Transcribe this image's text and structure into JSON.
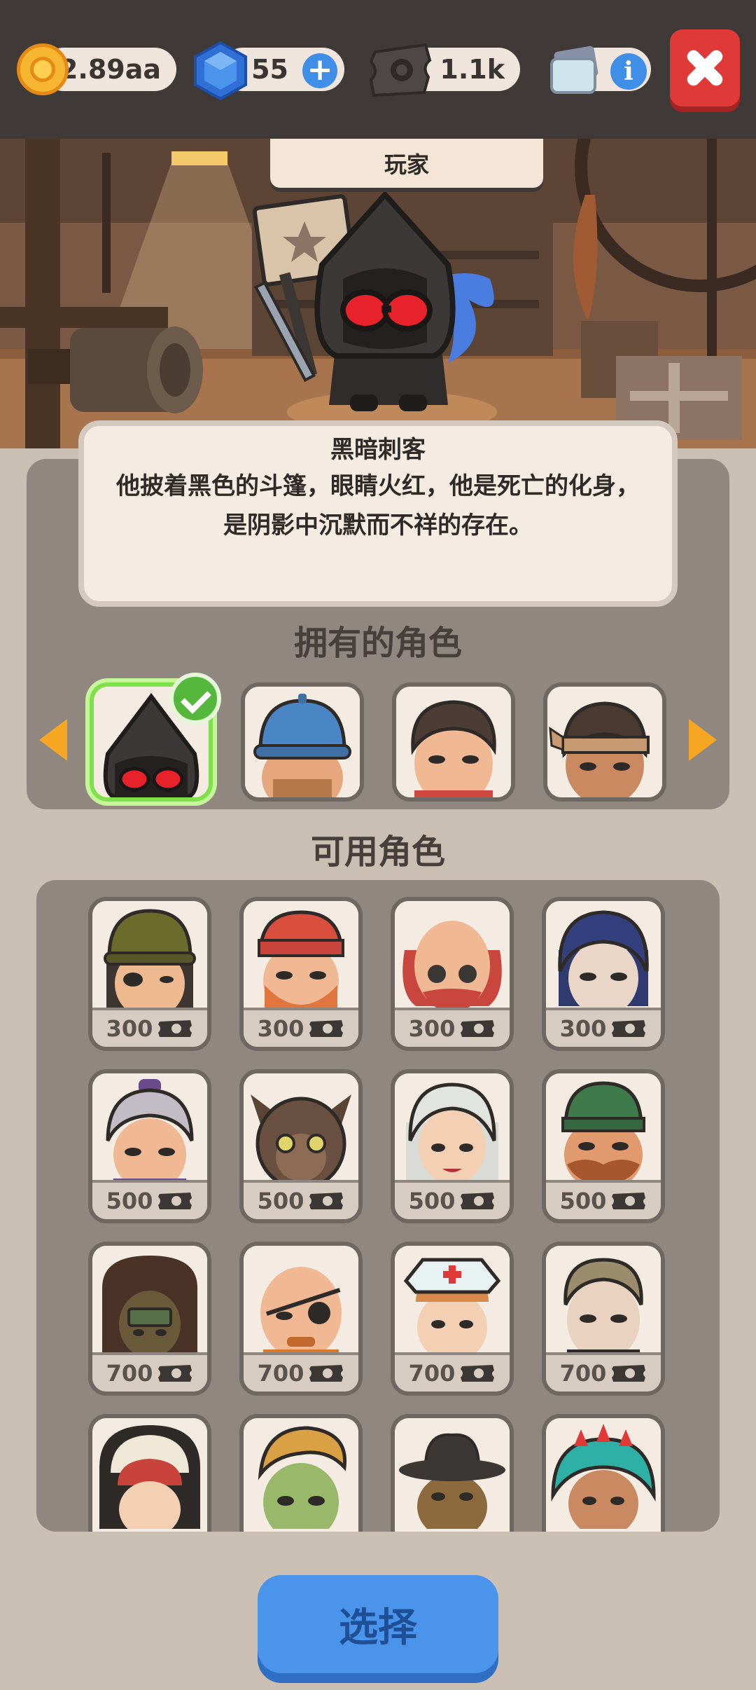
{
  "currency": {
    "coins": "2.89aa",
    "gems": "55",
    "tickets": "1.1k"
  },
  "header": {
    "player_label": "玩家"
  },
  "selected_character": {
    "name": "黑暗刺客",
    "description_line1": "他披着黑色的斗篷，眼睛火红，他是死亡的化身，",
    "description_line2": "是阴影中沉默而不祥的存在。"
  },
  "sections": {
    "owned_title": "拥有的角色",
    "available_title": "可用角色"
  },
  "owned_characters": [
    {
      "name": "dark-assassin",
      "selected": true
    },
    {
      "name": "blue-cap"
    },
    {
      "name": "brown-hair"
    },
    {
      "name": "headband-warrior"
    }
  ],
  "available_characters": [
    {
      "name": "army-helmet-eyepatch",
      "price": "300"
    },
    {
      "name": "red-beanie-beard",
      "price": "300"
    },
    {
      "name": "bald-red-beard-glasses",
      "price": "300"
    },
    {
      "name": "dark-blue-hair",
      "price": "300"
    },
    {
      "name": "granny-bun",
      "price": "500"
    },
    {
      "name": "werewolf",
      "price": "500"
    },
    {
      "name": "silver-hair-girl",
      "price": "500"
    },
    {
      "name": "green-beanie-mustache",
      "price": "500"
    },
    {
      "name": "dreadlocks",
      "price": "700"
    },
    {
      "name": "bald-eyepatch",
      "price": "700"
    },
    {
      "name": "nurse",
      "price": "700"
    },
    {
      "name": "slick-hair",
      "price": "700"
    },
    {
      "name": "nun"
    },
    {
      "name": "zombie"
    },
    {
      "name": "cowboy-hat"
    },
    {
      "name": "teal-hair-crown"
    }
  ],
  "buttons": {
    "select_label": "选择"
  },
  "colors": {
    "topbar": "#3f3a37",
    "panel": "#8f8780",
    "select_button": "#4a94ec",
    "close_button": "#e03a38",
    "selected_border": "#7ee04a",
    "arrow": "#f5a623"
  }
}
